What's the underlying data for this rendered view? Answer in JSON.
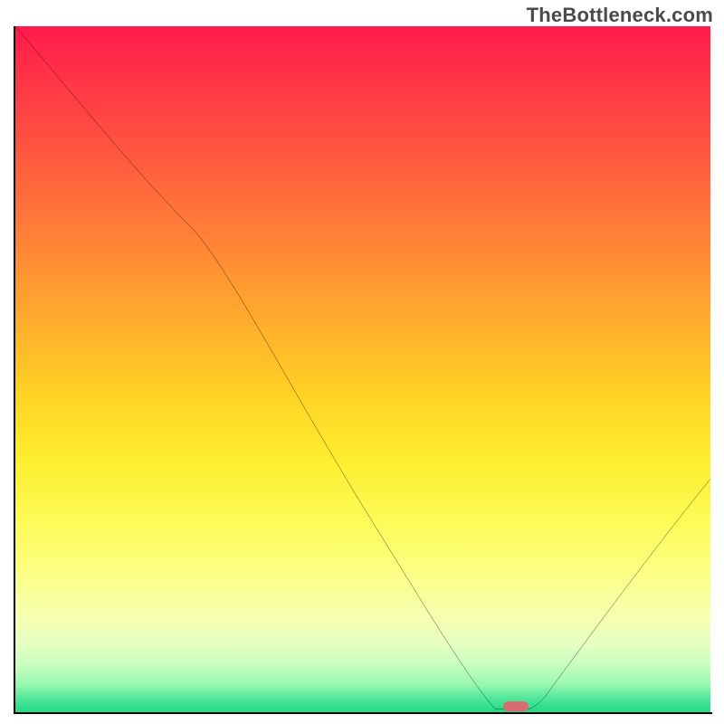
{
  "watermark": "TheBottleneck.com",
  "colors": {
    "gradient_top": "#ff1a4b",
    "gradient_bottom": "#1fd986",
    "curve": "#000000",
    "marker": "#d86b6f",
    "axis": "#000000"
  },
  "chart_data": {
    "type": "line",
    "title": "",
    "xlabel": "",
    "ylabel": "",
    "xlim": [
      0,
      100
    ],
    "ylim": [
      0,
      100
    ],
    "x": [
      0,
      25,
      69,
      74,
      76,
      100
    ],
    "y": [
      100,
      71,
      0.5,
      0.5,
      2,
      34
    ],
    "marker": {
      "x": 72,
      "y": 0.5
    },
    "annotations": [],
    "note": "Bottleneck curve over a vertical red-to-green gradient; minimum flat segment around x≈69–74 with a small rounded marker at the trough."
  }
}
